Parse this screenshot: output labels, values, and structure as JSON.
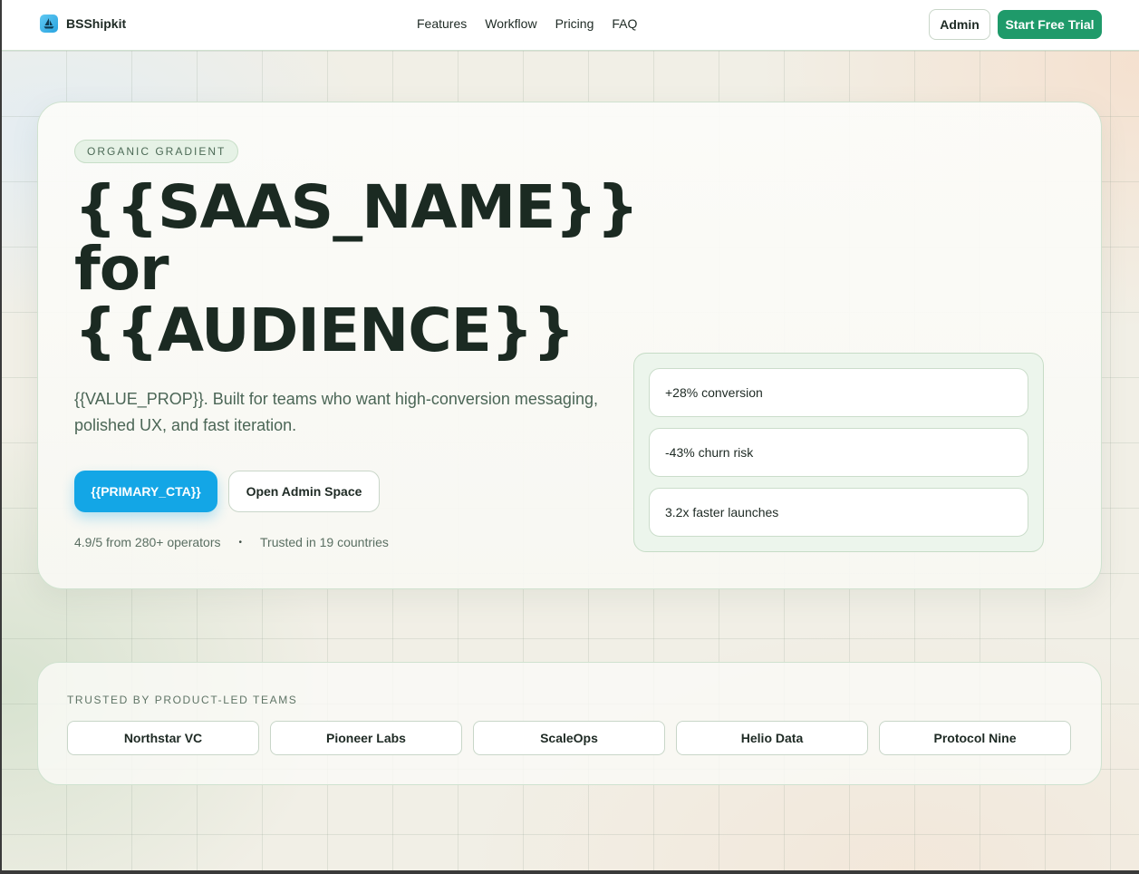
{
  "header": {
    "brand": "BSShipkit",
    "nav": [
      "Features",
      "Workflow",
      "Pricing",
      "FAQ"
    ],
    "admin_label": "Admin",
    "trial_label": "Start Free Trial"
  },
  "hero": {
    "pill": "ORGANIC GRADIENT",
    "title_line1": "{{SAAS_NAME}}",
    "title_line2": "for",
    "title_line3": "{{AUDIENCE}}",
    "subtitle": "{{VALUE_PROP}}. Built for teams who want high-conversion messaging, polished UX, and fast iteration.",
    "primary_cta": "{{PRIMARY_CTA}}",
    "secondary_cta": "Open Admin Space",
    "proof_rating": "4.9/5 from 280+ operators",
    "proof_separator": "•",
    "proof_countries": "Trusted in 19 countries",
    "stats": [
      "+28% conversion",
      "-43% churn risk",
      "3.2x faster launches"
    ]
  },
  "trusted": {
    "label": "TRUSTED BY PRODUCT-LED TEAMS",
    "logos": [
      "Northstar VC",
      "Pioneer Labs",
      "ScaleOps",
      "Helio Data",
      "Protocol Nine"
    ]
  },
  "colors": {
    "brand_green": "#1f9a6a",
    "primary_blue": "#13a6e6",
    "heading": "#1b2a22"
  },
  "icons": {
    "brand": "sailboat-icon"
  }
}
